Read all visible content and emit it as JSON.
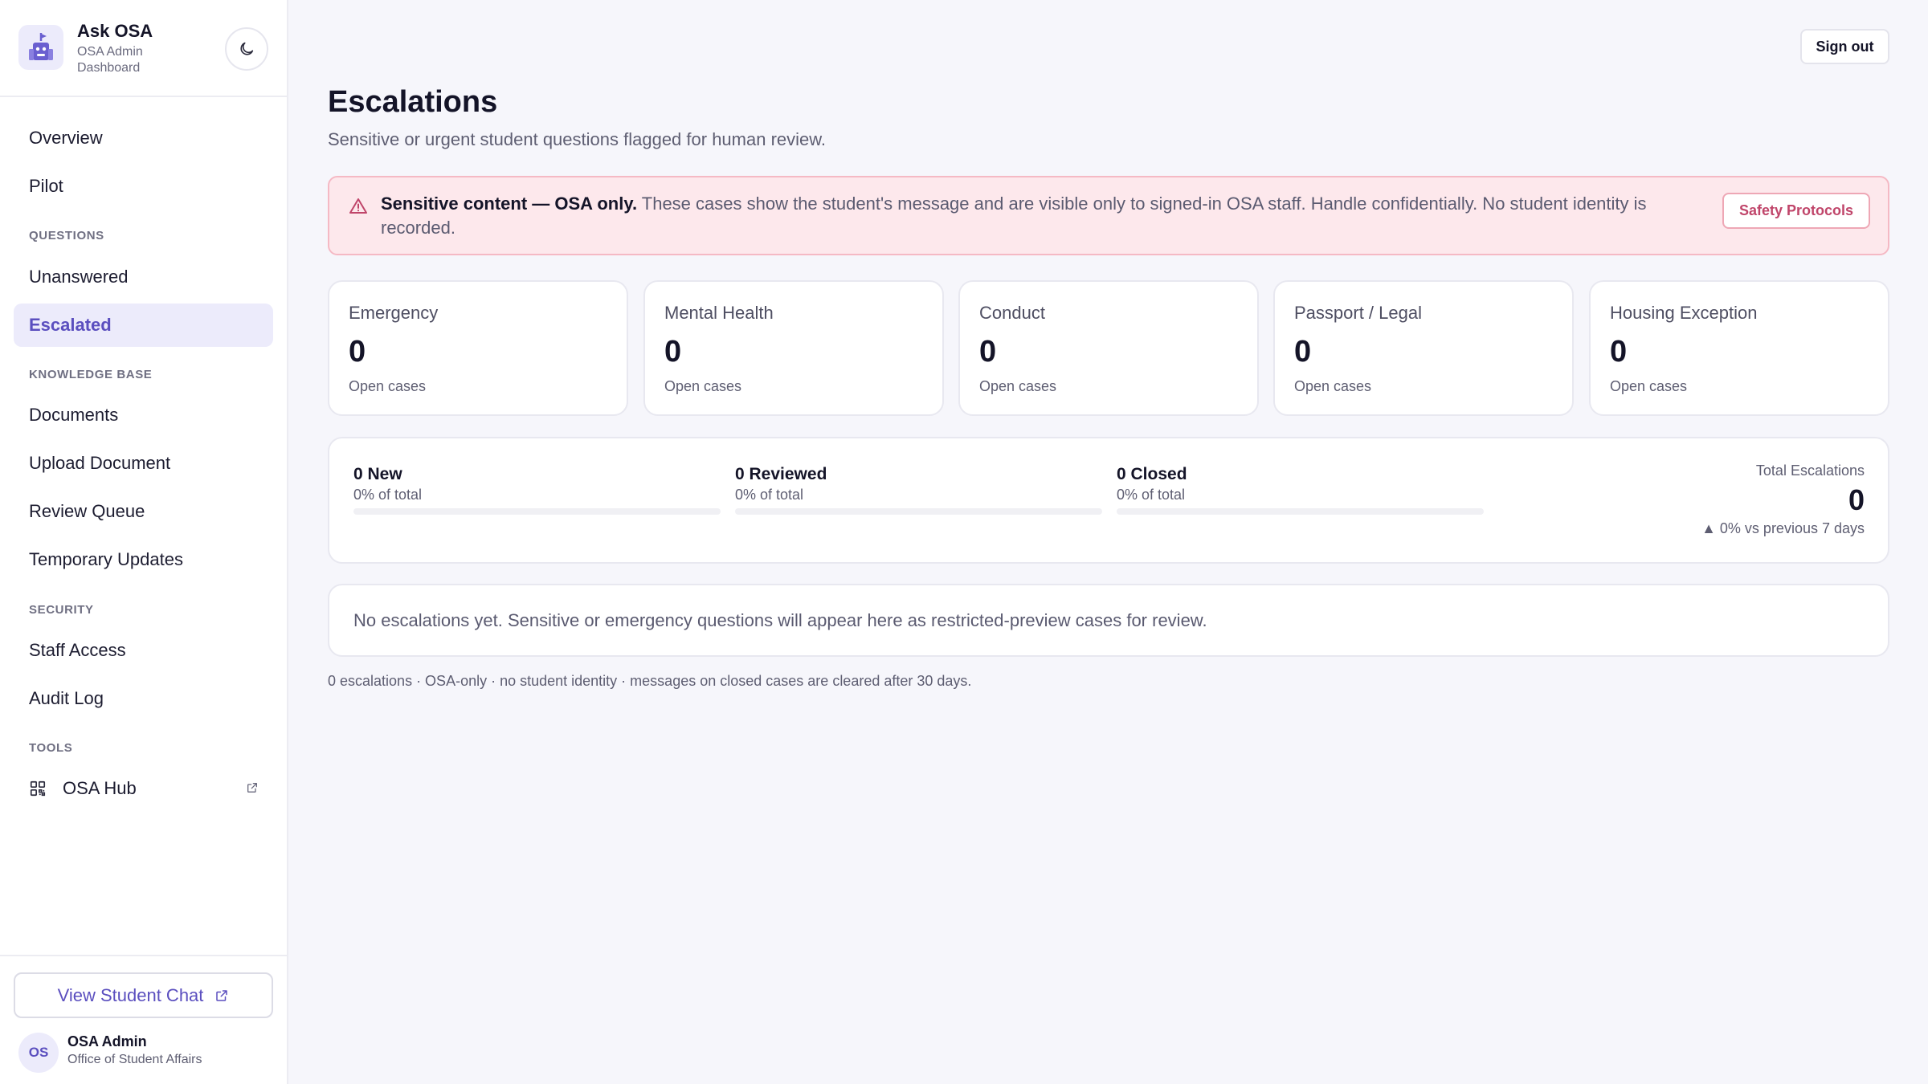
{
  "brand": {
    "title": "Ask OSA",
    "subtitle": "OSA Admin Dashboard",
    "logo_icon": "robot-building-icon",
    "theme_toggle_icon": "moon-icon"
  },
  "sidebar": {
    "top_items": [
      {
        "label": "Overview"
      },
      {
        "label": "Pilot"
      }
    ],
    "sections": [
      {
        "title": "QUESTIONS",
        "items": [
          {
            "label": "Unanswered",
            "active": false
          },
          {
            "label": "Escalated",
            "active": true
          }
        ]
      },
      {
        "title": "KNOWLEDGE BASE",
        "items": [
          {
            "label": "Documents"
          },
          {
            "label": "Upload Document"
          },
          {
            "label": "Review Queue"
          },
          {
            "label": "Temporary Updates"
          }
        ]
      },
      {
        "title": "SECURITY",
        "items": [
          {
            "label": "Staff Access"
          },
          {
            "label": "Audit Log"
          }
        ]
      },
      {
        "title": "TOOLS",
        "items": [
          {
            "label": "OSA Hub",
            "icon": "qr-grid-icon",
            "external": true
          }
        ]
      }
    ],
    "footer": {
      "student_chat_label": "View Student Chat",
      "user": {
        "initials": "OS",
        "name": "OSA Admin",
        "org": "Office of Student Affairs"
      }
    }
  },
  "header": {
    "sign_out_label": "Sign out"
  },
  "page": {
    "title": "Escalations",
    "subtitle": "Sensitive or urgent student questions flagged for human review."
  },
  "alert": {
    "bold": "Sensitive content — OSA only.",
    "text": " These cases show the student's message and are visible only to signed-in OSA staff. Handle confidentially. No student identity is recorded.",
    "button_label": "Safety Protocols",
    "icon": "warning-triangle-icon",
    "color": "#fde8ec"
  },
  "categories": [
    {
      "label": "Emergency",
      "count": "0",
      "foot": "Open cases"
    },
    {
      "label": "Mental Health",
      "count": "0",
      "foot": "Open cases"
    },
    {
      "label": "Conduct",
      "count": "0",
      "foot": "Open cases"
    },
    {
      "label": "Passport / Legal",
      "count": "0",
      "foot": "Open cases"
    },
    {
      "label": "Housing Exception",
      "count": "0",
      "foot": "Open cases"
    }
  ],
  "stats": {
    "items": [
      {
        "label": "0 New",
        "pct": "0% of total",
        "fraction": 0
      },
      {
        "label": "0 Reviewed",
        "pct": "0% of total",
        "fraction": 0
      },
      {
        "label": "0 Closed",
        "pct": "0% of total",
        "fraction": 0
      }
    ],
    "total_label": "Total Escalations",
    "total_value": "0",
    "trend": "▲ 0% vs previous 7 days"
  },
  "empty_state": "No escalations yet. Sensitive or emergency questions will appear here as restricted-preview cases for review.",
  "footnote": "0 escalations · OSA-only · no student identity · messages on closed cases are cleared after 30 days.",
  "colors": {
    "accent": "#5b4fbf",
    "accent_bg": "#ecebfb",
    "alert_border": "#f5b9c4",
    "alert_button": "#c0456a"
  }
}
